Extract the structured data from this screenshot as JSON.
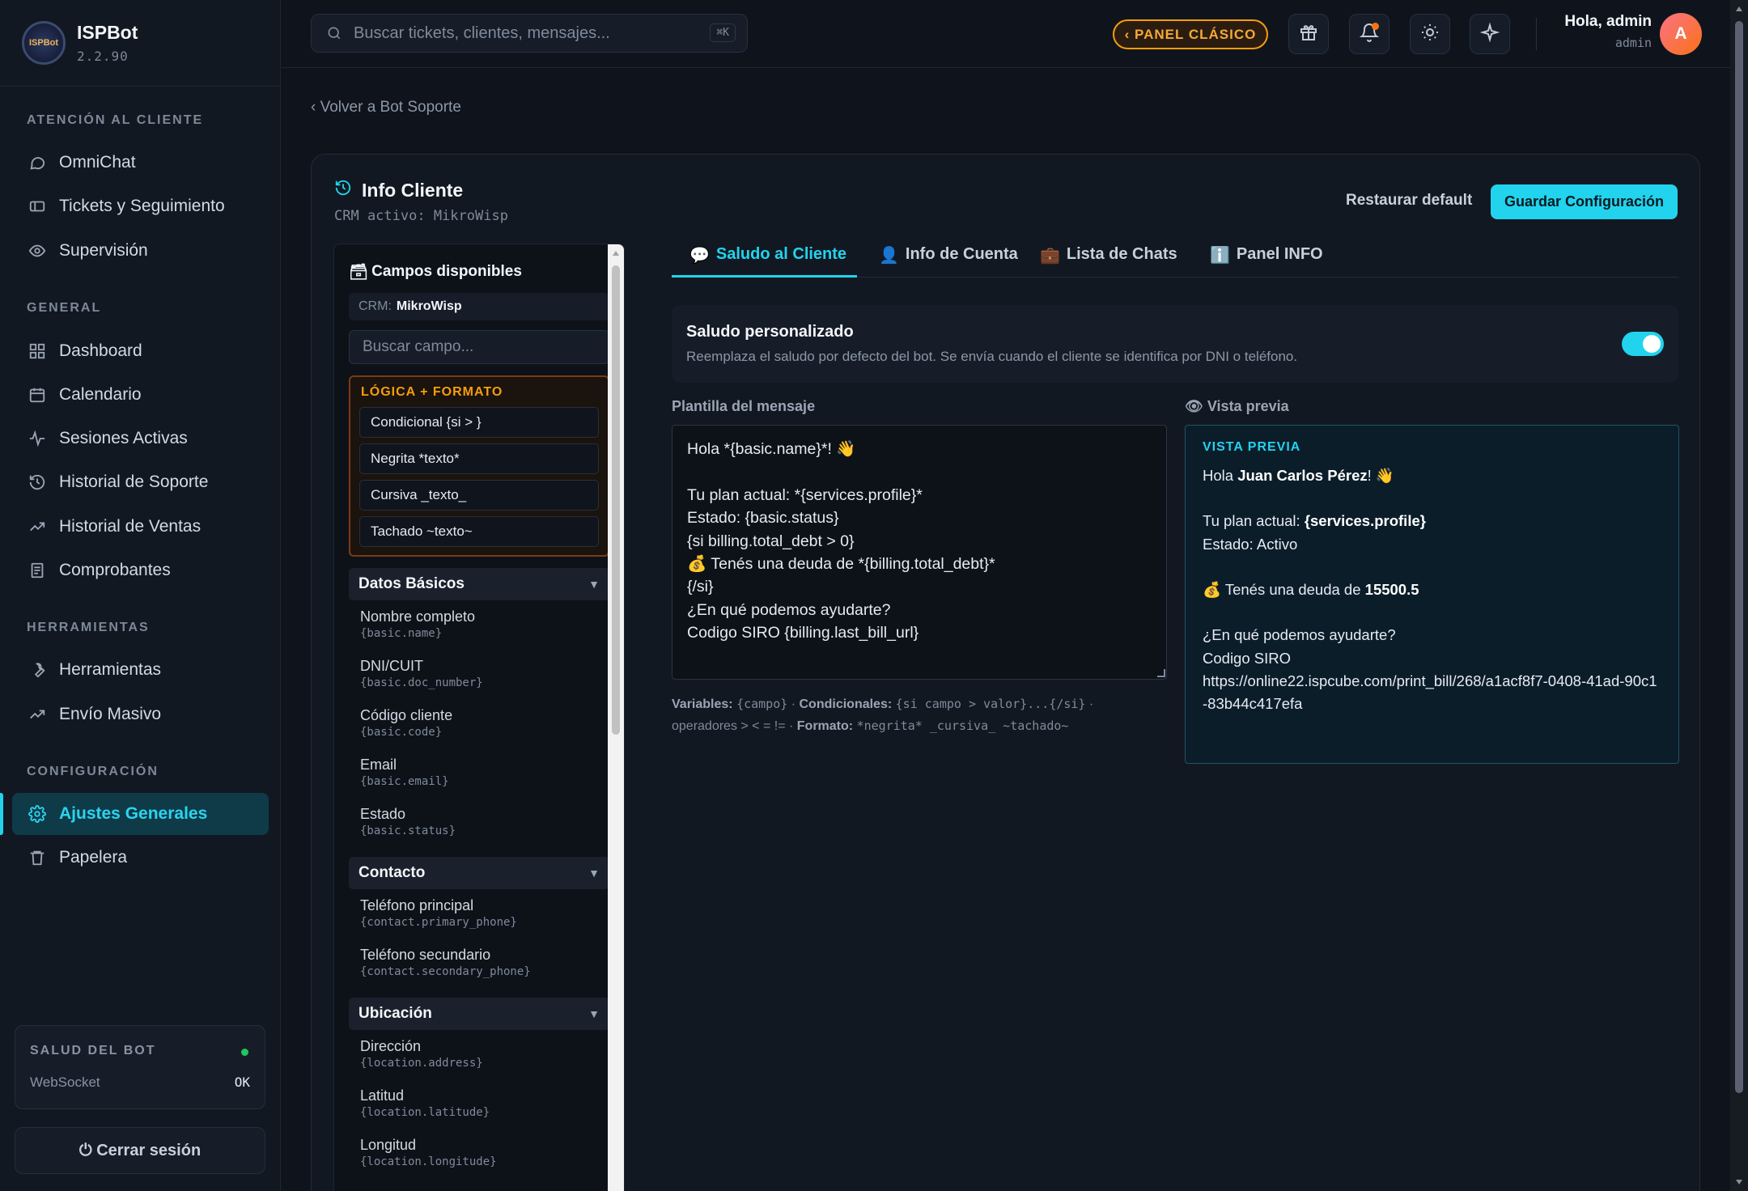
{
  "brand": {
    "name": "ISPBot",
    "version": "2.2.90",
    "logo_text": "ISPBot"
  },
  "sidebar": {
    "sections": [
      {
        "title": "ATENCIÓN AL CLIENTE",
        "items": [
          {
            "label": "OmniChat",
            "icon": "chat-icon"
          },
          {
            "label": "Tickets y Seguimiento",
            "icon": "ticket-icon"
          },
          {
            "label": "Supervisión",
            "icon": "eye-icon"
          }
        ]
      },
      {
        "title": "GENERAL",
        "items": [
          {
            "label": "Dashboard",
            "icon": "grid-icon"
          },
          {
            "label": "Calendario",
            "icon": "calendar-icon"
          },
          {
            "label": "Sesiones Activas",
            "icon": "activity-icon"
          },
          {
            "label": "Historial de Soporte",
            "icon": "history-icon"
          },
          {
            "label": "Historial de Ventas",
            "icon": "trending-icon"
          },
          {
            "label": "Comprobantes",
            "icon": "receipt-icon"
          }
        ]
      },
      {
        "title": "HERRAMIENTAS",
        "items": [
          {
            "label": "Herramientas",
            "icon": "wrench-icon"
          },
          {
            "label": "Envío Masivo",
            "icon": "trending-icon"
          }
        ]
      },
      {
        "title": "CONFIGURACIÓN",
        "items": [
          {
            "label": "Ajustes Generales",
            "icon": "gear-icon",
            "active": true
          },
          {
            "label": "Papelera",
            "icon": "trash-icon"
          }
        ]
      }
    ],
    "health": {
      "title": "SALUD DEL BOT",
      "label": "WebSocket",
      "value": "OK"
    },
    "logout": "⏻ Cerrar sesión"
  },
  "topbar": {
    "search_placeholder": "Buscar tickets, clientes, mensajes...",
    "shortcut": "⌘K",
    "panel_button": "‹  PANEL CLÁSICO",
    "greeting": "Hola, admin",
    "role": "admin",
    "avatar": "A"
  },
  "back_link": "‹ Volver a Bot Soporte",
  "card": {
    "title": "Info Cliente",
    "subtitle": "CRM activo: MikroWisp",
    "restore": "Restaurar default",
    "save": "Guardar Configuración"
  },
  "fields": {
    "title": "Campos disponibles",
    "crm_label": "CRM:",
    "crm_value": "MikroWisp",
    "search_placeholder": "Buscar campo...",
    "logic_title": "LÓGICA + FORMATO",
    "logic_items": [
      "Condicional {si > }",
      "Negrita *texto*",
      "Cursiva _texto_",
      "Tachado ~texto~"
    ],
    "groups": [
      {
        "title": "Datos Básicos",
        "items": [
          {
            "name": "Nombre completo",
            "key": "{basic.name}"
          },
          {
            "name": "DNI/CUIT",
            "key": "{basic.doc_number}"
          },
          {
            "name": "Código cliente",
            "key": "{basic.code}"
          },
          {
            "name": "Email",
            "key": "{basic.email}"
          },
          {
            "name": "Estado",
            "key": "{basic.status}"
          }
        ]
      },
      {
        "title": "Contacto",
        "items": [
          {
            "name": "Teléfono principal",
            "key": "{contact.primary_phone}"
          },
          {
            "name": "Teléfono secundario",
            "key": "{contact.secondary_phone}"
          }
        ]
      },
      {
        "title": "Ubicación",
        "items": [
          {
            "name": "Dirección",
            "key": "{location.address}"
          },
          {
            "name": "Latitud",
            "key": "{location.latitude}"
          },
          {
            "name": "Longitud",
            "key": "{location.longitude}"
          }
        ]
      }
    ]
  },
  "tabs": [
    {
      "emoji": "💬",
      "label": "Saludo al Cliente",
      "active": true
    },
    {
      "emoji": "👤",
      "label": "Info de Cuenta"
    },
    {
      "emoji": "💼",
      "label": "Lista de Chats"
    },
    {
      "emoji": "ℹ️",
      "label": "Panel INFO"
    }
  ],
  "greeting": {
    "title": "Saludo personalizado",
    "description": "Reemplaza el saludo por defecto del bot. Se envía cuando el cliente se identifica por DNI o teléfono.",
    "enabled": true
  },
  "template": {
    "label": "Plantilla del mensaje",
    "text": "Hola *{basic.name}*! 👋\n\nTu plan actual: *{services.profile}*\nEstado: {basic.status}\n{si billing.total_debt > 0}\n💰 Tenés una deuda de *{billing.total_debt}*\n{/si}\n¿En qué podemos ayudarte?\nCodigo SIRO {billing.last_bill_url}",
    "help": {
      "variables_label": "Variables:",
      "variables_value": "{campo}",
      "conditionals_label": "Condicionales:",
      "conditionals_value": "{si campo > valor}...{/si}",
      "operators": "operadores > < = != ·",
      "format_label": "Formato:",
      "format_value": "*negrita* _cursiva_ ~tachado~"
    }
  },
  "preview": {
    "label": "Vista previa",
    "title": "VISTA PREVIA",
    "hello": "Hola",
    "name": "Juan Carlos Pérez",
    "wave": "! 👋",
    "plan_label": "Tu plan actual:",
    "plan_value": "{services.profile}",
    "status_line": "Estado: Activo",
    "debt_label": "💰 Tenés una deuda de",
    "debt_value": "15500.5",
    "help_line": "¿En qué podemos ayudarte?",
    "siro_label": "Codigo SIRO",
    "siro_url": "https://online22.ispcube.com/print_bill/268/a1acf8f7-0408-41ad-90c1-83b44c417efa"
  }
}
